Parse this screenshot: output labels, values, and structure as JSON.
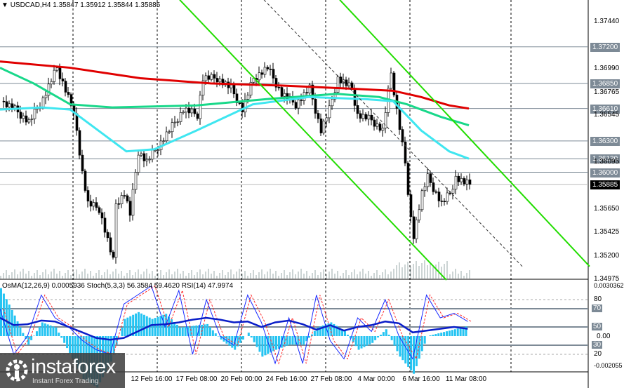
{
  "header": {
    "symbol": "USDCAD,H4",
    "open": "1.35847",
    "high": "1.35912",
    "low": "1.35844",
    "close": "1.35885"
  },
  "indicator_header": "OsMA(12,26,9) 0.0005936  Stoch(5,3,3) 56.3584 59.4620  RSI(14) 47.9974",
  "logo": {
    "name": "instaforex",
    "tagline": "Instant Forex Trading"
  },
  "colors": {
    "bull": "#000000",
    "ma_red": "#e00000",
    "ma_green": "#18d88a",
    "ma_cyan": "#3fe6f0",
    "channel": "#22dd00",
    "osma": "#25c4f2",
    "rsi": "#0a1ec8",
    "stoch_main": "#1a2aff",
    "stoch_signal": "#ff2a2a",
    "level": "#7d8a96"
  },
  "chart_data": {
    "type": "candlestick",
    "title": "USDCAD,H4",
    "price_axis_ticks": [
      "1.37440",
      "1.36990",
      "1.36765",
      "1.36545",
      "1.36095",
      "1.35650",
      "1.35425",
      "1.35200",
      "1.34975"
    ],
    "price_range": [
      1.34975,
      1.3744
    ],
    "level_tags": [
      "1.37200",
      "1.36850",
      "1.36610",
      "1.36300",
      "1.36130",
      "1.36000"
    ],
    "current_price": "1.35885",
    "time_labels": [
      "12 Feb 16:00",
      "17 Feb 08:00",
      "20 Feb 00:00",
      "24 Feb 16:00",
      "27 Feb 08:00",
      "4 Mar 00:00",
      "6 Mar 16:00",
      "11 Mar 08:00"
    ],
    "close_path": [
      [
        0,
        1.3668
      ],
      [
        5,
        1.366
      ],
      [
        10,
        1.3648
      ],
      [
        15,
        1.367
      ],
      [
        20,
        1.37
      ],
      [
        25,
        1.3665
      ],
      [
        27,
        1.364
      ],
      [
        29,
        1.36
      ],
      [
        31,
        1.357
      ],
      [
        35,
        1.3565
      ],
      [
        37,
        1.3545
      ],
      [
        40,
        1.3515
      ],
      [
        41,
        1.357
      ],
      [
        44,
        1.358
      ],
      [
        46,
        1.356
      ],
      [
        49,
        1.362
      ],
      [
        52,
        1.361
      ],
      [
        56,
        1.3625
      ],
      [
        60,
        1.364
      ],
      [
        65,
        1.366
      ],
      [
        70,
        1.3655
      ],
      [
        72,
        1.369
      ],
      [
        77,
        1.369
      ],
      [
        82,
        1.368
      ],
      [
        86,
        1.366
      ],
      [
        90,
        1.369
      ],
      [
        95,
        1.37
      ],
      [
        100,
        1.3675
      ],
      [
        105,
        1.3665
      ],
      [
        110,
        1.368
      ],
      [
        114,
        1.364
      ],
      [
        117,
        1.366
      ],
      [
        120,
        1.369
      ],
      [
        125,
        1.368
      ],
      [
        127,
        1.3655
      ],
      [
        132,
        1.365
      ],
      [
        136,
        1.364
      ],
      [
        139,
        1.3695
      ],
      [
        141,
        1.366
      ],
      [
        144,
        1.361
      ],
      [
        145,
        1.3575
      ],
      [
        147,
        1.354
      ],
      [
        150,
        1.358
      ],
      [
        152,
        1.3595
      ],
      [
        155,
        1.358
      ],
      [
        157,
        1.357
      ],
      [
        160,
        1.358
      ],
      [
        162,
        1.3595
      ],
      [
        165,
        1.359
      ],
      [
        167,
        1.35885
      ]
    ],
    "ma_red": [
      [
        0,
        1.3706
      ],
      [
        25,
        1.37
      ],
      [
        50,
        1.369
      ],
      [
        75,
        1.3685
      ],
      [
        100,
        1.3683
      ],
      [
        125,
        1.368
      ],
      [
        140,
        1.3678
      ],
      [
        150,
        1.3672
      ],
      [
        160,
        1.3664
      ],
      [
        167,
        1.3661
      ]
    ],
    "ma_green": [
      [
        0,
        1.37
      ],
      [
        12,
        1.3685
      ],
      [
        25,
        1.3665
      ],
      [
        40,
        1.3662
      ],
      [
        70,
        1.3664
      ],
      [
        95,
        1.367
      ],
      [
        120,
        1.3675
      ],
      [
        135,
        1.3672
      ],
      [
        145,
        1.3665
      ],
      [
        157,
        1.3653
      ],
      [
        167,
        1.3645
      ]
    ],
    "ma_cyan": [
      [
        0,
        1.366
      ],
      [
        15,
        1.3662
      ],
      [
        25,
        1.366
      ],
      [
        35,
        1.364
      ],
      [
        45,
        1.362
      ],
      [
        55,
        1.3622
      ],
      [
        70,
        1.364
      ],
      [
        90,
        1.3665
      ],
      [
        110,
        1.3672
      ],
      [
        130,
        1.367
      ],
      [
        140,
        1.3668
      ],
      [
        150,
        1.364
      ],
      [
        160,
        1.362
      ],
      [
        167,
        1.3613
      ]
    ],
    "channels": [
      [
        [
          64,
          1.3765
        ],
        [
          159,
          1.3497
        ]
      ],
      [
        [
          121,
          1.3765
        ],
        [
          210,
          1.351
        ]
      ]
    ],
    "dashed_trend": [
      [
        94,
        1.3765
      ],
      [
        186,
        1.351
      ]
    ],
    "indicator": {
      "range": [
        0,
        100
      ],
      "levels": [
        "80",
        "70",
        "50",
        "30",
        "20"
      ],
      "osma_ticks": [
        "0.0030362",
        "0.00",
        "-0.002055"
      ],
      "rsi": [
        60,
        52,
        53,
        57,
        56,
        50,
        44,
        38,
        36,
        38,
        45,
        52,
        53,
        55,
        58,
        60,
        58,
        55,
        56,
        50,
        55,
        57,
        53,
        47,
        52,
        46,
        50,
        52,
        56,
        54,
        44,
        46,
        48,
        50,
        48
      ],
      "stoch": [
        70,
        20,
        40,
        85,
        60,
        50,
        35,
        25,
        20,
        75,
        85,
        95,
        50,
        90,
        20,
        80,
        40,
        30,
        85,
        55,
        10,
        60,
        10,
        85,
        35,
        15,
        60,
        45,
        80,
        40,
        15,
        85,
        60,
        65,
        56
      ],
      "osma": [
        0.0028,
        0.0012,
        -0.0005,
        0.0008,
        0.0005,
        -0.001,
        -0.0025,
        -0.003,
        -0.0015,
        0.001,
        0.0014,
        0.001,
        0.0013,
        0.0005,
        0.0006,
        0.0007,
        -0.0002,
        -0.0008,
        0.0002,
        -0.0012,
        -0.0008,
        -0.0005,
        -0.0005,
        0.0005,
        0.0008,
        0.0003,
        -0.0008,
        -0.0004,
        0.0004,
        -0.0012,
        -0.0022,
        0.0,
        0.0002,
        0.0004,
        0.0006
      ]
    }
  }
}
